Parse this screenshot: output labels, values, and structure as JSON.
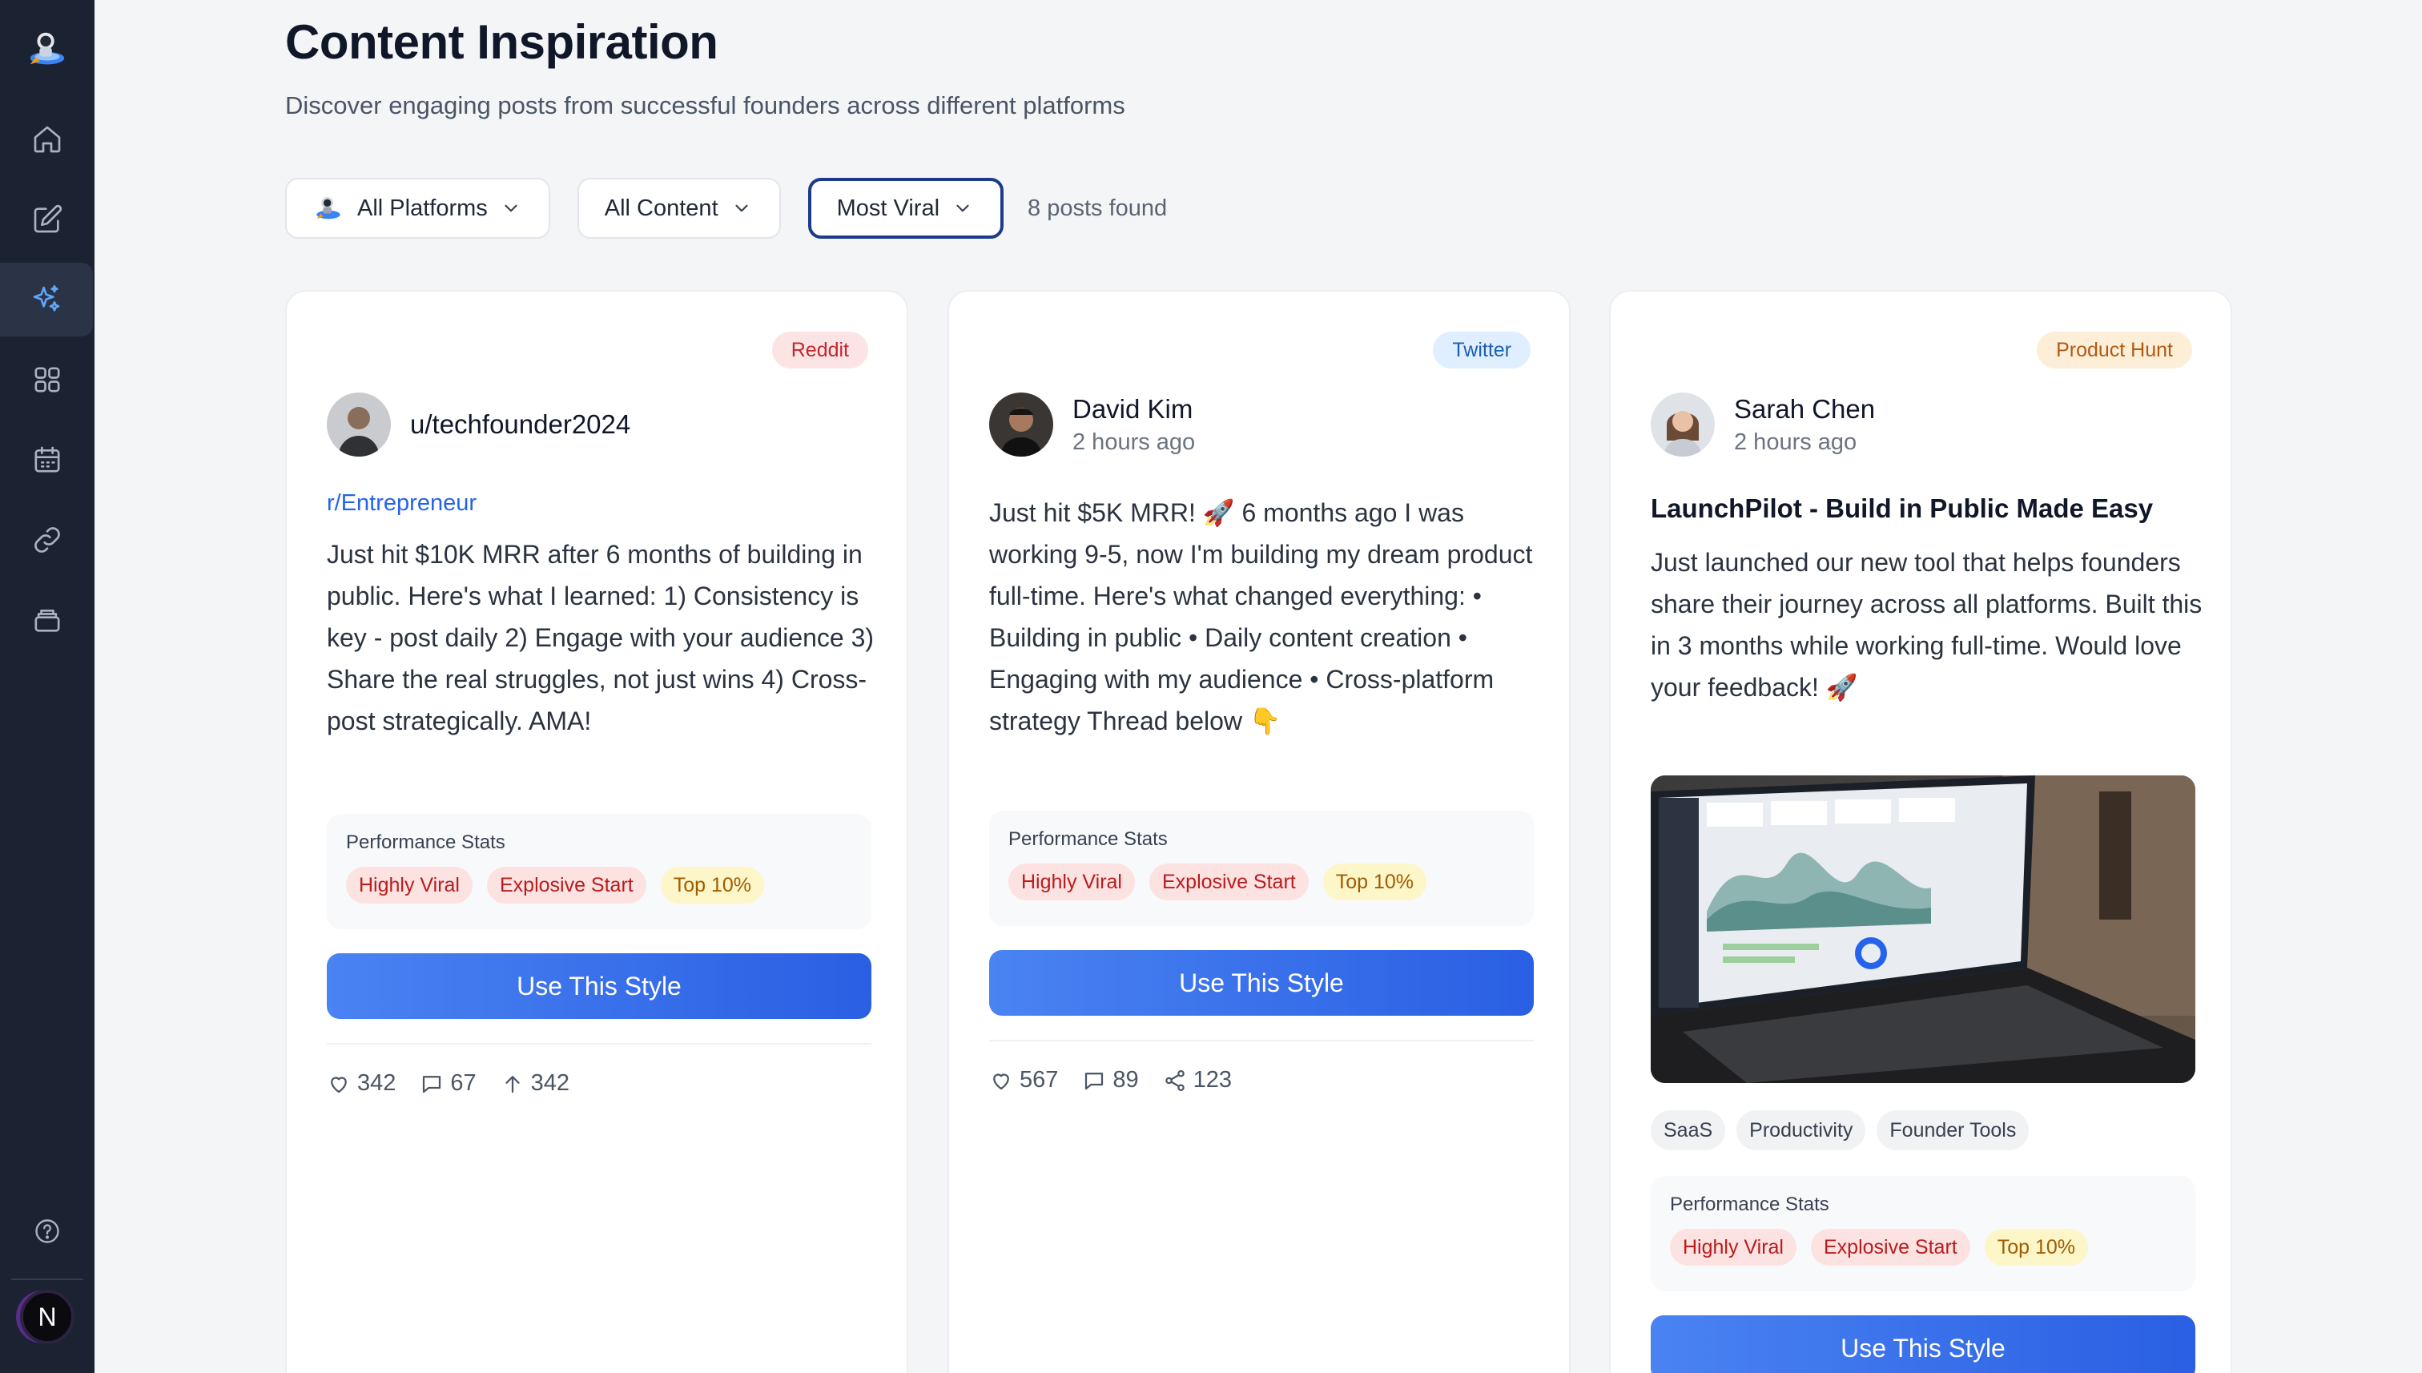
{
  "sidebar": {
    "logo": "rocket-astronaut-logo",
    "nav": [
      {
        "icon": "home-icon"
      },
      {
        "icon": "edit-icon"
      },
      {
        "icon": "sparkles-icon",
        "active": true
      },
      {
        "icon": "grid-icon"
      },
      {
        "icon": "calendar-icon"
      },
      {
        "icon": "link-icon"
      },
      {
        "icon": "archive-icon"
      }
    ],
    "help_icon": "help-circle-icon",
    "user_initial": "N"
  },
  "header": {
    "title": "Content Inspiration",
    "subtitle": "Discover engaging posts from successful founders across different platforms"
  },
  "filters": {
    "platform": "All Platforms",
    "content": "All Content",
    "sort": "Most Viral",
    "count_text": "8 posts found"
  },
  "posts": [
    {
      "platform": "Reddit",
      "author": "u/techfounder2024",
      "subreddit": "r/Entrepreneur",
      "body": "Just hit $10K MRR after 6 months of building in public. Here's what I learned: 1) Consistency is key - post daily 2) Engage with your audience 3) Share the real struggles, not just wins 4) Cross-post strategically. AMA!",
      "stats_title": "Performance Stats",
      "chips": [
        "Highly Viral",
        "Explosive Start",
        "Top 10%"
      ],
      "button": "Use This Style",
      "likes": "342",
      "comments": "67",
      "upvotes": "342"
    },
    {
      "platform": "Twitter",
      "author": "David Kim",
      "time": "2 hours ago",
      "body": "Just hit $5K MRR! 🚀 6 months ago I was working 9-5, now I'm building my dream product full-time. Here's what changed everything: • Building in public • Daily content creation • Engaging with my audience • Cross-platform strategy Thread below 👇",
      "stats_title": "Performance Stats",
      "chips": [
        "Highly Viral",
        "Explosive Start",
        "Top 10%"
      ],
      "button": "Use This Style",
      "likes": "567",
      "comments": "89",
      "shares": "123"
    },
    {
      "platform": "Product Hunt",
      "author": "Sarah Chen",
      "time": "2 hours ago",
      "title": "LaunchPilot - Build in Public Made Easy",
      "body": "Just launched our new tool that helps founders share their journey across all platforms. Built this in 3 months while working full-time. Would love your feedback! 🚀",
      "tags": [
        "SaaS",
        "Productivity",
        "Founder Tools"
      ],
      "stats_title": "Performance Stats",
      "chips": [
        "Highly Viral",
        "Explosive Start",
        "Top 10%"
      ],
      "button": "Use This Style"
    }
  ]
}
